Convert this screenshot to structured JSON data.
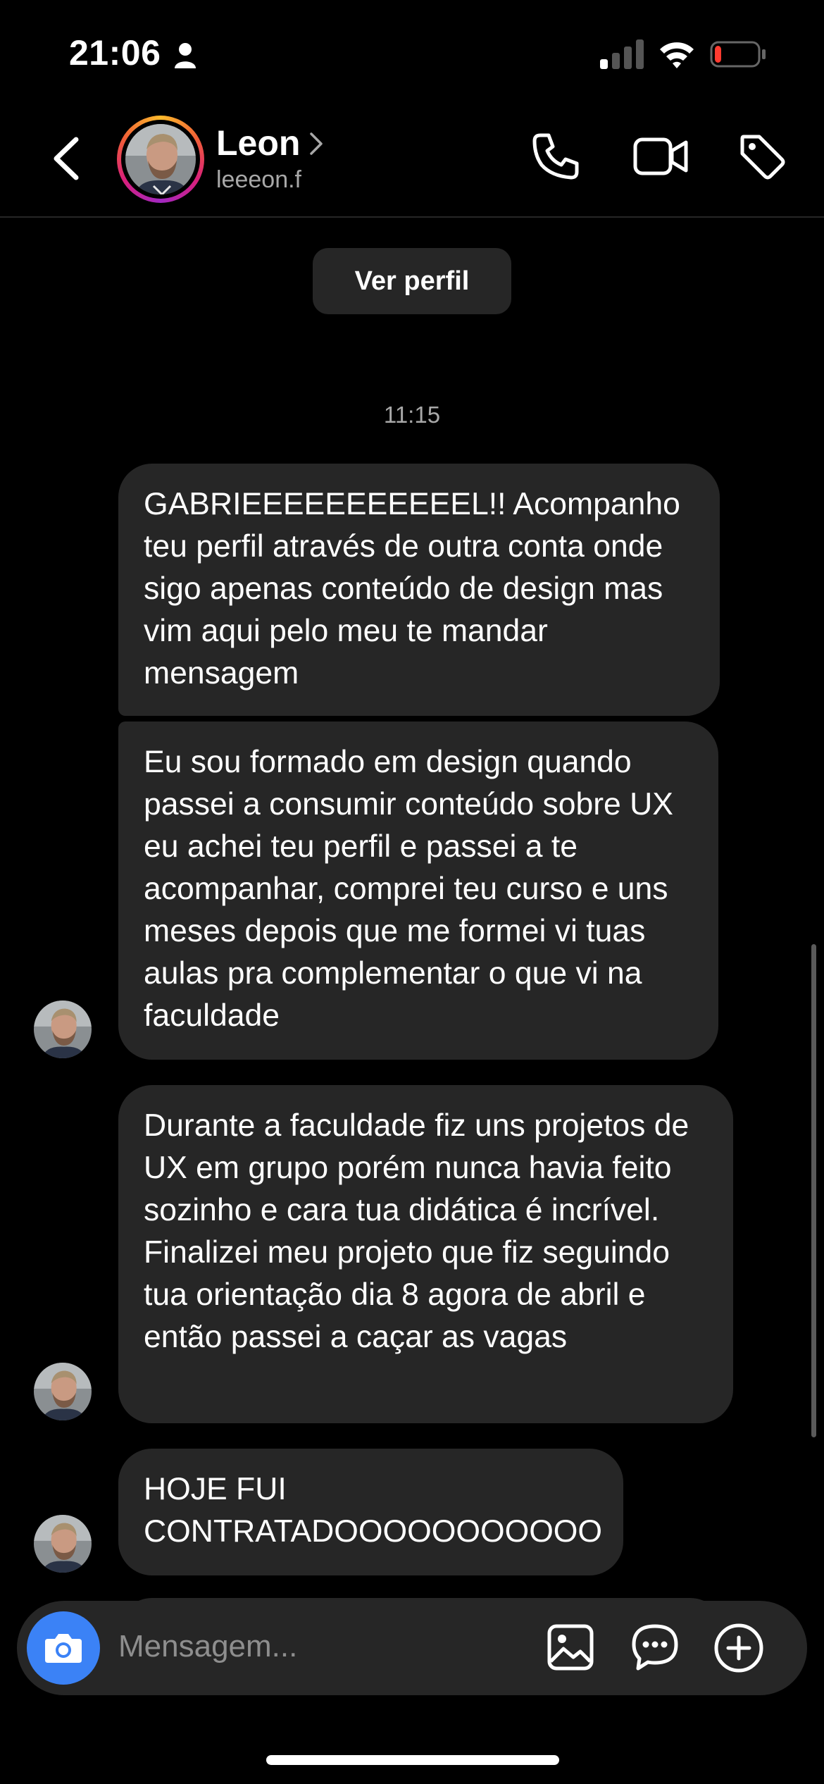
{
  "status_bar": {
    "time": "21:06"
  },
  "header": {
    "contact_name": "Leon",
    "contact_handle": "leeeon.f"
  },
  "chat": {
    "view_profile_label": "Ver perfil",
    "timestamp": "11:15",
    "messages": [
      {
        "text": "GABRIEEEEEEEEEEEL!! Acompanho teu perfil através de outra conta onde sigo apenas conteúdo de design mas vim aqui pelo meu te mandar mensagem"
      },
      {
        "text": "Eu sou formado em design quando passei a consumir conteúdo sobre UX eu achei teu perfil e passei a te acompanhar, comprei teu curso e uns meses depois que me formei vi tuas aulas pra complementar o que vi na faculdade"
      },
      {
        "text": "Durante a faculdade fiz uns projetos de UX em grupo porém nunca havia feito sozinho e cara tua didática é incrível. Finalizei meu projeto que fiz seguindo tua orientação dia 8 agora de abril e então passei a caçar as vagas"
      },
      {
        "text": "HOJE FUI CONTRATADOOOOOOOOOOO"
      }
    ]
  },
  "composer": {
    "placeholder": "Mensagem..."
  },
  "colors": {
    "background": "#000000",
    "bubble": "#262626",
    "camera_accent": "#3b82f6",
    "secondary_text": "#a8a8a8",
    "battery_low": "#ff3b30"
  },
  "battery_level": 0.15,
  "signal_bars_active": 1
}
